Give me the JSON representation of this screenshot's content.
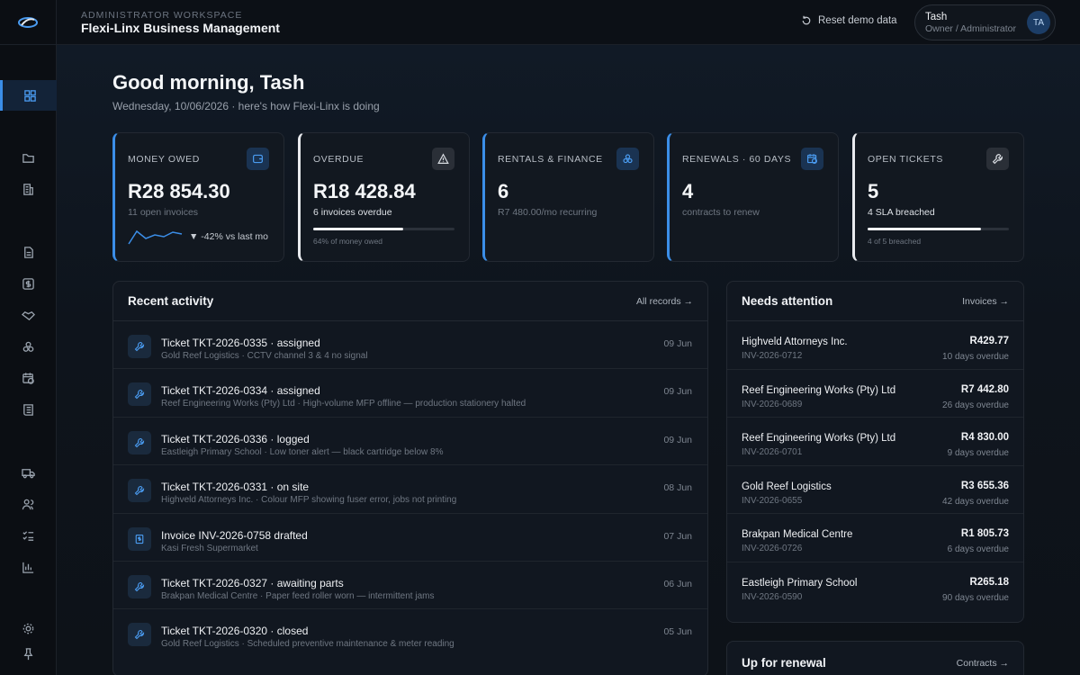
{
  "app": {
    "workspace_label": "ADMINISTRATOR WORKSPACE",
    "title": "Flexi-Linx Business Management",
    "reset_label": "Reset demo data"
  },
  "user": {
    "name": "Tash",
    "role": "Owner / Administrator",
    "initials": "TA"
  },
  "sidebar": {
    "items": [
      {
        "icon": "dashboard-icon"
      },
      {
        "icon": "folder-icon"
      },
      {
        "icon": "building-icon"
      },
      {
        "icon": "document-icon"
      },
      {
        "icon": "dollar-icon"
      },
      {
        "icon": "handshake-icon"
      },
      {
        "icon": "rentals-icon"
      },
      {
        "icon": "calendar-clock-icon"
      },
      {
        "icon": "receipt-icon"
      },
      {
        "icon": "truck-icon"
      },
      {
        "icon": "users-icon"
      },
      {
        "icon": "checklist-icon"
      },
      {
        "icon": "bar-chart-icon"
      },
      {
        "icon": "settings-icon"
      },
      {
        "icon": "pin-icon"
      }
    ]
  },
  "header": {
    "greeting": "Good morning, Tash",
    "subtitle": "Wednesday, 10/06/2026 · here's how Flexi-Linx is doing"
  },
  "stats": [
    {
      "label": "MONEY OWED",
      "value": "R28 854.30",
      "sub": "11 open invoices",
      "trend": "▼ -42% vs last mo",
      "icon": "wallet-icon"
    },
    {
      "label": "OVERDUE",
      "value": "R18 428.84",
      "sub": "6 invoices overdue",
      "progress": 0.64,
      "note": "64% of money owed",
      "icon": "warning-icon"
    },
    {
      "label": "RENTALS & FINANCE",
      "value": "6",
      "sub": "R7 480.00/mo recurring",
      "icon": "rentals-icon"
    },
    {
      "label": "RENEWALS · 60 DAYS",
      "value": "4",
      "sub": "contracts to renew",
      "icon": "calendar-clock-icon"
    },
    {
      "label": "OPEN TICKETS",
      "value": "5",
      "sub": "4 SLA breached",
      "progress": 0.8,
      "note": "4 of 5 breached",
      "icon": "wrench-icon"
    }
  ],
  "activity": {
    "title": "Recent activity",
    "link": "All records →",
    "items": [
      {
        "title": "Ticket TKT-2026-0335 · assigned",
        "desc": "Gold Reef Logistics · CCTV channel 3 & 4 no signal",
        "date": "09 Jun",
        "icon": "wrench-icon"
      },
      {
        "title": "Ticket TKT-2026-0334 · assigned",
        "desc": "Reef Engineering Works (Pty) Ltd · High-volume MFP offline — production stationery halted",
        "date": "09 Jun",
        "icon": "wrench-icon"
      },
      {
        "title": "Ticket TKT-2026-0336 · logged",
        "desc": "Eastleigh Primary School · Low toner alert — black cartridge below 8%",
        "date": "09 Jun",
        "icon": "wrench-icon"
      },
      {
        "title": "Ticket TKT-2026-0331 · on site",
        "desc": "Highveld Attorneys Inc. · Colour MFP showing fuser error, jobs not printing",
        "date": "08 Jun",
        "icon": "wrench-icon"
      },
      {
        "title": "Invoice INV-2026-0758 drafted",
        "desc": "Kasi Fresh Supermarket",
        "date": "07 Jun",
        "icon": "invoice-icon"
      },
      {
        "title": "Ticket TKT-2026-0327 · awaiting parts",
        "desc": "Brakpan Medical Centre · Paper feed roller worn — intermittent jams",
        "date": "06 Jun",
        "icon": "wrench-icon"
      },
      {
        "title": "Ticket TKT-2026-0320 · closed",
        "desc": "Gold Reef Logistics · Scheduled preventive maintenance & meter reading",
        "date": "05 Jun",
        "icon": "wrench-icon"
      }
    ]
  },
  "attention": {
    "title": "Needs attention",
    "link": "Invoices →",
    "items": [
      {
        "name": "Highveld Attorneys Inc.",
        "invoice": "INV-2026-0712",
        "amount": "R429.77",
        "overdue": "10 days overdue"
      },
      {
        "name": "Reef Engineering Works (Pty) Ltd",
        "invoice": "INV-2026-0689",
        "amount": "R7 442.80",
        "overdue": "26 days overdue"
      },
      {
        "name": "Reef Engineering Works (Pty) Ltd",
        "invoice": "INV-2026-0701",
        "amount": "R4 830.00",
        "overdue": "9 days overdue"
      },
      {
        "name": "Gold Reef Logistics",
        "invoice": "INV-2026-0655",
        "amount": "R3 655.36",
        "overdue": "42 days overdue"
      },
      {
        "name": "Brakpan Medical Centre",
        "invoice": "INV-2026-0726",
        "amount": "R1 805.73",
        "overdue": "6 days overdue"
      },
      {
        "name": "Eastleigh Primary School",
        "invoice": "INV-2026-0590",
        "amount": "R265.18",
        "overdue": "90 days overdue"
      }
    ]
  },
  "renewal": {
    "title": "Up for renewal",
    "link": "Contracts →"
  },
  "colors": {
    "accent": "#3b8ee8",
    "background": "#0d1117",
    "card": "#121820"
  }
}
